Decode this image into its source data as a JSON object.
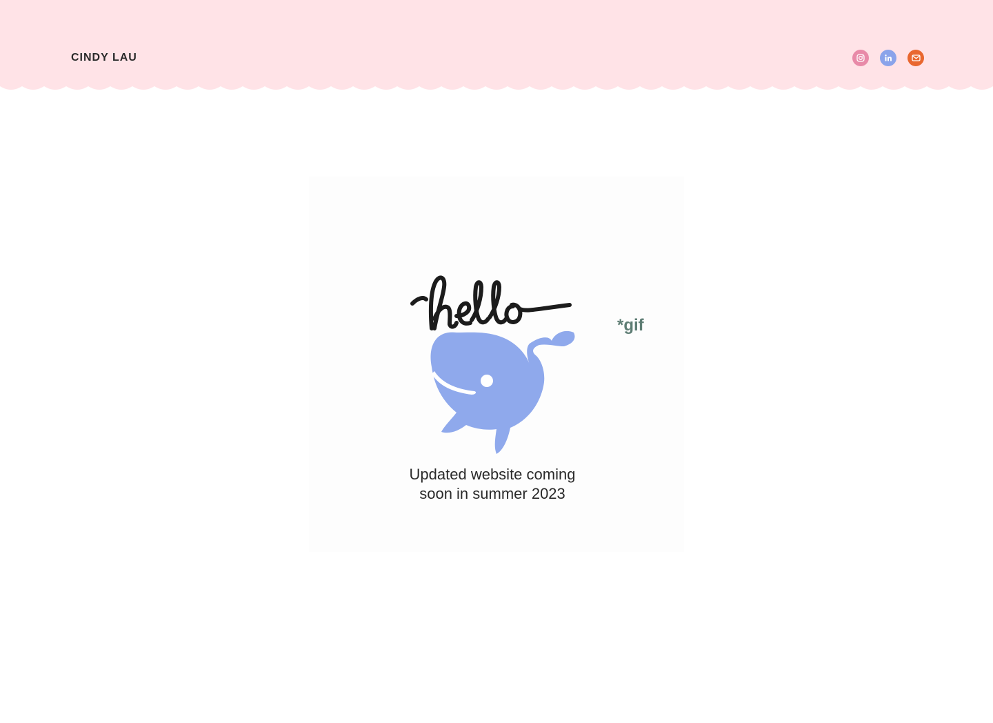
{
  "header": {
    "brand": "CINDY LAU",
    "background_color": "#ffe3e7",
    "socials": [
      {
        "icon": "instagram-icon",
        "color": "#e88aa8"
      },
      {
        "icon": "linkedin-icon",
        "color": "#8aa3ea"
      },
      {
        "icon": "mail-icon",
        "color": "#e9672f"
      }
    ]
  },
  "main": {
    "gif_note": "*gif",
    "tagline_line1": "Updated website coming",
    "tagline_line2": "soon in summer 2023",
    "illustration": {
      "hand_lettering": "hello",
      "whale_color": "#8fa9ec"
    }
  }
}
